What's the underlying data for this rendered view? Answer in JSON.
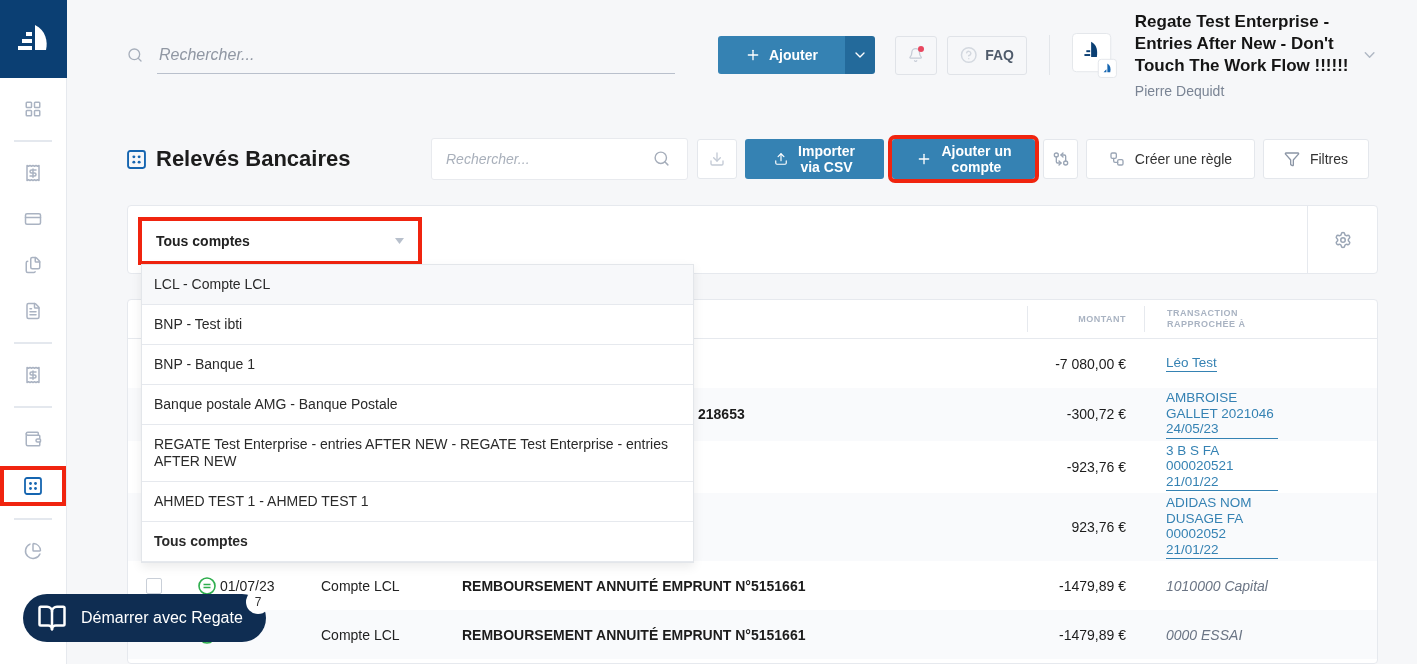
{
  "sidebar": {
    "groups": [
      [
        {
          "kind": "grid",
          "selected": false,
          "highlighted": false
        }
      ],
      [
        {
          "kind": "receipt",
          "selected": false,
          "highlighted": false
        },
        {
          "kind": "card",
          "selected": false,
          "highlighted": false
        },
        {
          "kind": "documents",
          "selected": false,
          "highlighted": false
        },
        {
          "kind": "euro",
          "selected": false,
          "highlighted": false
        }
      ],
      [
        {
          "kind": "receipt",
          "selected": false,
          "highlighted": false
        }
      ],
      [
        {
          "kind": "wallet",
          "selected": false,
          "highlighted": false
        },
        {
          "kind": "statements",
          "selected": true,
          "highlighted": true
        }
      ],
      [
        {
          "kind": "pie",
          "selected": false,
          "highlighted": false
        }
      ]
    ]
  },
  "header": {
    "search": {
      "placeholder": "Rechercher..."
    },
    "add_button": "Ajouter",
    "notifications": {
      "unread": true
    },
    "faq": "FAQ",
    "company": "Regate Test Enterprise - Entries After New - Don't Touch The Work Flow !!!!!!",
    "user": "Pierre Dequidt"
  },
  "page": {
    "title": "Relevés Bancaires",
    "search": {
      "placeholder": "Rechercher..."
    },
    "actions": [
      {
        "kind": "download",
        "highlighted": false
      },
      {
        "kind": "import",
        "label": "Importer\nvia CSV",
        "highlighted": false
      },
      {
        "kind": "add",
        "label": "Ajouter un\ncompte",
        "highlighted": true
      },
      {
        "kind": "swap",
        "highlighted": false
      },
      {
        "kind": "rule",
        "label": "Créer une règle",
        "highlighted": false
      },
      {
        "kind": "filter",
        "label": "Filtres",
        "highlighted": false
      }
    ]
  },
  "account_filter": {
    "value": "Tous comptes",
    "highlighted": true,
    "expanded": true,
    "options": [
      {
        "label": "LCL - Compte LCL",
        "selected": false,
        "hovered": true
      },
      {
        "label": "BNP - Test ibti",
        "selected": false,
        "hovered": false
      },
      {
        "label": "BNP - Banque 1",
        "selected": false,
        "hovered": false
      },
      {
        "label": "Banque postale AMG - Banque Postale",
        "selected": false,
        "hovered": false
      },
      {
        "label": "REGATE Test Enterprise - entries AFTER NEW - REGATE Test Enterprise - entries AFTER NEW",
        "selected": false,
        "hovered": false
      },
      {
        "label": "AHMED TEST 1 - AHMED TEST 1",
        "selected": false,
        "hovered": false
      },
      {
        "label": "Tous comptes",
        "selected": true,
        "hovered": false
      }
    ]
  },
  "table": {
    "columns": [
      {
        "label": "MONTANT"
      },
      {
        "label": "TRANSACTION RAPPROCHÉE À"
      }
    ],
    "rows": [
      {
        "amount": "-7 080,00 €",
        "match": {
          "kind": "link",
          "text": "Léo Test"
        }
      },
      {
        "description": "218653",
        "covered": true,
        "amount": "-300,72 €",
        "match": {
          "kind": "link",
          "text": "AMBROISE GALLET 2021046 24/05/23"
        }
      },
      {
        "amount": "-923,76 €",
        "match": {
          "kind": "link",
          "text": "3 B S FA 000020521 21/01/22"
        }
      },
      {
        "amount": "923,76 €",
        "match": {
          "kind": "link",
          "text": "ADIDAS NOM DUSAGE FA 00002052 21/01/22"
        }
      },
      {
        "checked": false,
        "date": "01/07/23",
        "account": "Compte LCL",
        "description": "REMBOURSEMENT ANNUITÉ EMPRUNT N°5151661",
        "covered": false,
        "amount": "-1479,89 €",
        "match": {
          "kind": "account",
          "text": "1010000 Capital"
        }
      },
      {
        "account": "Compte LCL",
        "description": "REMBOURSEMENT ANNUITÉ EMPRUNT N°5151661",
        "covered": false,
        "amount": "-1479,89 €",
        "match": {
          "kind": "account",
          "text": "0000 ESSAI"
        }
      }
    ]
  },
  "onboarding": {
    "label": "Démarrer avec Regate",
    "count": "7"
  }
}
